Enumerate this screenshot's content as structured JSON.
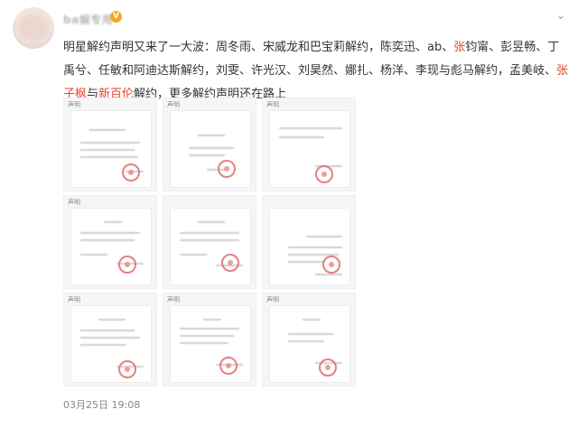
{
  "post": {
    "username": "ba娱专用",
    "text_parts": [
      {
        "t": "明星解约声明又来了一大波：周冬雨、宋威龙和巴宝莉解约，陈奕迅、ab、",
        "hl": false
      },
      {
        "t": "张",
        "hl": true
      },
      {
        "t": "钧甯、彭昱畅、丁禹兮、任敏和阿迪达斯解约，刘雯、许光汉、刘昊然、娜扎、杨洋、李现与彪马解约，孟美岐、",
        "hl": false
      },
      {
        "t": "张子枫",
        "hl": true
      },
      {
        "t": "与",
        "hl": false
      },
      {
        "t": "新百伦",
        "hl": true
      },
      {
        "t": "解约，更多解约声明还在路上",
        "hl": false
      }
    ],
    "thumbnail_labels": [
      "声明",
      "声明",
      "声明",
      "声明",
      "",
      "",
      "声明",
      "声明",
      "声明"
    ],
    "timestamp": "03月25日 19:08"
  },
  "icons": {
    "verify": "verified-badge-icon",
    "chevron": "chevron-down-icon"
  },
  "colors": {
    "highlight": "#e8432e",
    "seal": "#e26b6b"
  }
}
